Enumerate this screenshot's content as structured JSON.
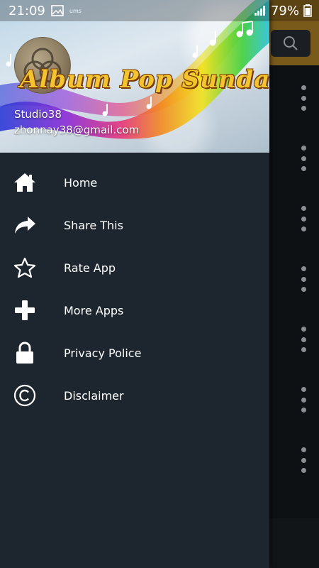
{
  "status_bar": {
    "time": "21:09",
    "notif_tag": "ums",
    "battery": "79%"
  },
  "header": {
    "title": "Album Pop Sunda",
    "name": "Studio38",
    "email": "zhonnay38@gmail.com"
  },
  "menu": {
    "items": [
      {
        "label": "Home",
        "icon": "home-icon"
      },
      {
        "label": "Share This",
        "icon": "share-icon"
      },
      {
        "label": "Rate App",
        "icon": "star-icon"
      },
      {
        "label": "More Apps",
        "icon": "plus-icon"
      },
      {
        "label": "Privacy Police",
        "icon": "lock-icon"
      },
      {
        "label": "Disclaimer",
        "icon": "copyright-icon"
      }
    ]
  },
  "colors": {
    "drawer_bg": "#1d262f",
    "app_bg": "#0d1114",
    "topbar": "#7a5a1a",
    "title": "#f2c530"
  }
}
